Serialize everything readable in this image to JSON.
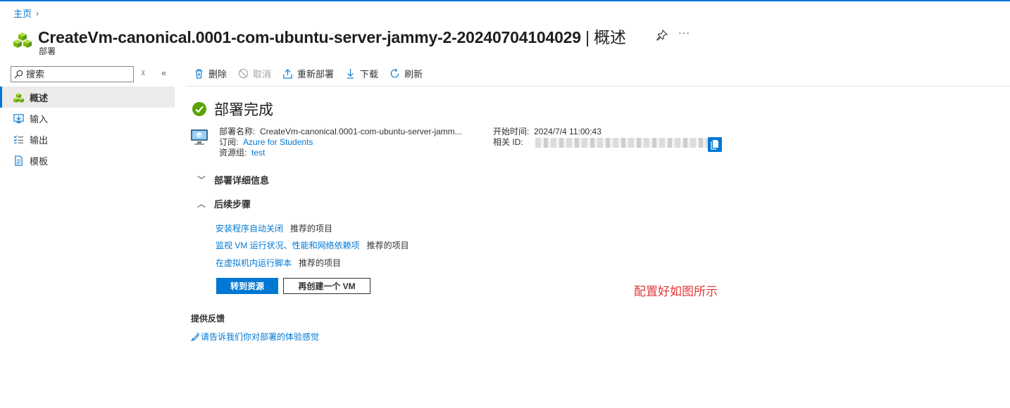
{
  "breadcrumb": {
    "home": "主页"
  },
  "header": {
    "title": "CreateVm-canonical.0001-com-ubuntu-server-jammy-2-20240704104029",
    "separator": "|",
    "section": "概述",
    "subtitle": "部署",
    "more": "···",
    "icon": "cubes-icon"
  },
  "sidebar": {
    "search_placeholder": "搜索",
    "items": [
      {
        "label": "概述",
        "icon": "overview-icon",
        "active": true
      },
      {
        "label": "输入",
        "icon": "input-icon"
      },
      {
        "label": "输出",
        "icon": "output-icon"
      },
      {
        "label": "模板",
        "icon": "template-icon"
      }
    ]
  },
  "toolbar": {
    "delete": "删除",
    "cancel": "取消",
    "redeploy": "重新部署",
    "download": "下载",
    "refresh": "刷新"
  },
  "status": {
    "title": "部署完成",
    "color": "#57a300"
  },
  "details": {
    "name_label": "部署名称:",
    "name_value": "CreateVm-canonical.0001-com-ubuntu-server-jamm...",
    "subscription_label": "订阅:",
    "subscription_value": "Azure for Students",
    "resource_group_label": "资源组:",
    "resource_group_value": "test",
    "start_time_label": "开始时间:",
    "start_time_value": "2024/7/4 11:00:43",
    "correlation_label": "相关 ID:"
  },
  "sections": {
    "details_title": "部署详细信息",
    "next_steps_title": "后续步骤"
  },
  "next_steps": [
    {
      "link": "安装程序自动关闭",
      "tag": "推荐的项目"
    },
    {
      "link": "监视 VM 运行状况、性能和网络依赖项",
      "tag": "推荐的项目"
    },
    {
      "link": "在虚拟机内运行脚本",
      "tag": "推荐的项目"
    }
  ],
  "actions": {
    "go_to_resource": "转到资源",
    "create_another": "再创建一个 VM"
  },
  "annotation": "配置好如图所示",
  "feedback": {
    "title": "提供反馈",
    "link": "请告诉我们你对部署的体验感觉"
  },
  "colors": {
    "accent": "#0078d4",
    "annotation": "#e03a3a"
  }
}
